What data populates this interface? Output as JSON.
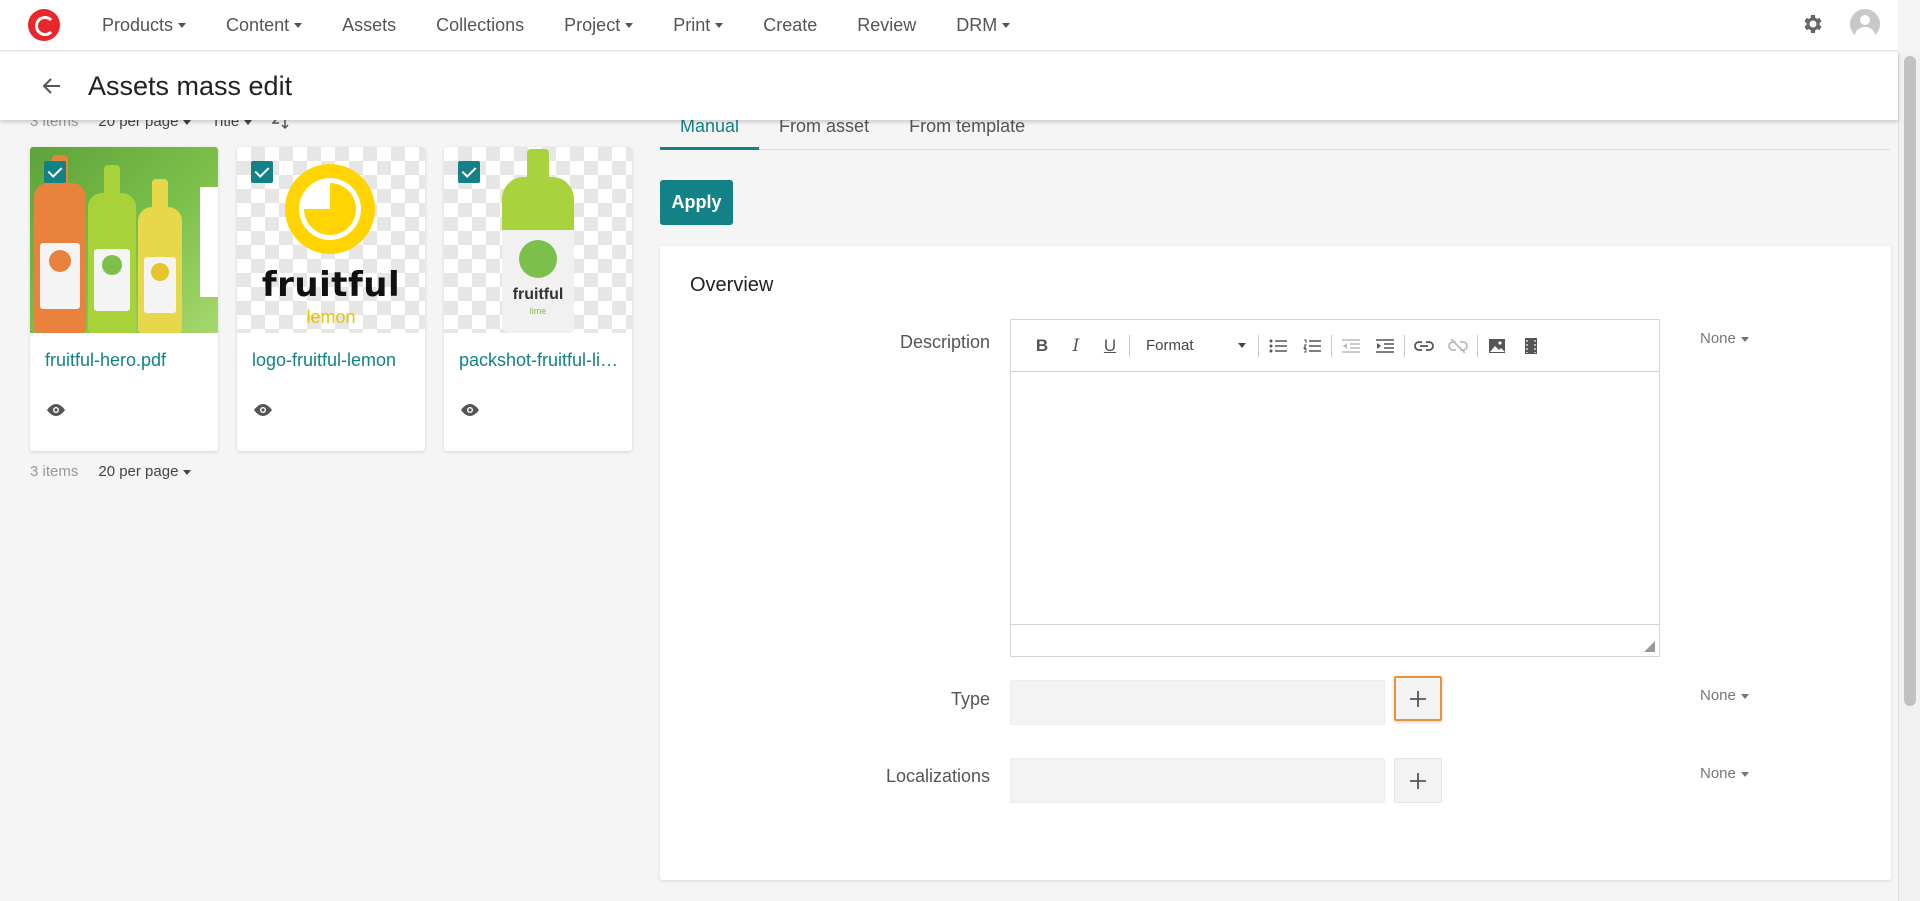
{
  "nav": {
    "items": [
      {
        "label": "Products",
        "dropdown": true
      },
      {
        "label": "Content",
        "dropdown": true
      },
      {
        "label": "Assets",
        "dropdown": false
      },
      {
        "label": "Collections",
        "dropdown": false
      },
      {
        "label": "Project",
        "dropdown": true
      },
      {
        "label": "Print",
        "dropdown": true
      },
      {
        "label": "Create",
        "dropdown": false
      },
      {
        "label": "Review",
        "dropdown": false
      },
      {
        "label": "DRM",
        "dropdown": true
      }
    ],
    "icons": [
      "logo-icon",
      "gear-icon",
      "avatar-icon"
    ]
  },
  "header": {
    "title": "Assets mass edit",
    "back_icon": "arrow-left-icon"
  },
  "list": {
    "count": "3 items",
    "per_page": "20 per page",
    "sort": "Title",
    "sort_icon": "sort-z-a-icon",
    "cards": [
      {
        "title": "fruitful-hero.pdf",
        "checked": true
      },
      {
        "title": "logo-fruitful-lemon",
        "checked": true,
        "logo_word": "fruitful",
        "logo_sub": "lemon"
      },
      {
        "title": "packshot-fruitful-lime",
        "checked": true,
        "logo_word": "fruitful",
        "logo_sub": "lime"
      }
    ],
    "footer_count": "3 items",
    "footer_per_page": "20 per page"
  },
  "tabs": [
    {
      "label": "Manual",
      "active": true
    },
    {
      "label": "From asset",
      "active": false
    },
    {
      "label": "From template",
      "active": false
    }
  ],
  "apply_label": "Apply",
  "overview": {
    "title": "Overview",
    "description_label": "Description",
    "format_label": "Format",
    "type_label": "Type",
    "localizations_label": "Localizations",
    "none_label": "None"
  },
  "colors": {
    "accent": "#128286",
    "focus": "#e8923b",
    "brand": "#e8262c"
  }
}
